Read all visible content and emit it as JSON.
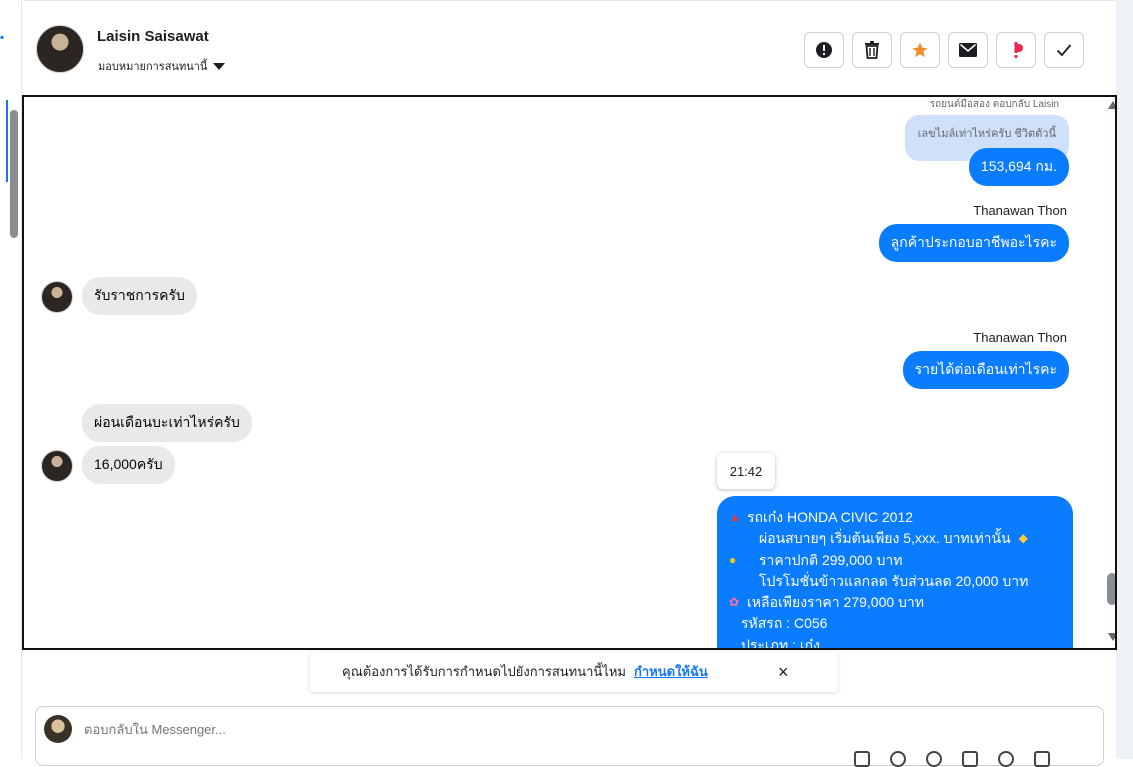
{
  "header": {
    "contact_name": "Laisin Saisawat",
    "assign_label": "มอบหมายการสนทนานี้",
    "actions": [
      {
        "name": "spam-button",
        "icon": "exclamation-circle-icon"
      },
      {
        "name": "delete-button",
        "icon": "trash-icon"
      },
      {
        "name": "star-button",
        "icon": "star-icon",
        "color": "#f28c28"
      },
      {
        "name": "unread-button",
        "icon": "envelope-icon"
      },
      {
        "name": "follow-up-button",
        "icon": "exclamation-icon",
        "color": "#e41e3f"
      },
      {
        "name": "done-button",
        "icon": "checkmark-icon"
      }
    ]
  },
  "chat": {
    "reply_meta": "รถยนต์มือสอง ตอบกลับ Laisin",
    "reply_quote": "เลขไมล์เท่าไหร่ครับ ชีวิตตัวนี้",
    "messages": {
      "m1": "153,694 กม.",
      "sender1": "Thanawan Thon",
      "m2": "ลูกค้าประกอบอาชีพอะไรคะ",
      "m3": "รับราชการครับ",
      "sender2": "Thanawan Thon",
      "m4": "รายได้ต่อเดือนเท่าไรคะ",
      "m5": "ผ่อนเดือนบะเท่าไหร่ครับ",
      "m6": "16,000ครับ"
    },
    "timestamp": "21:42",
    "long_message": {
      "line1": "รถเก๋ง HONDA CIVIC 2012",
      "line2": "ผ่อนสบายๆ เริ่มต้นเพียง 5,xxx. บาทเท่านั้น",
      "line3": "ราคาปกติ  299,000 บาท",
      "line4": "โปรโมชั่นข้าวแลกลด รับส่วนลด 20,000 บาท",
      "line5": "เหลือเพียงราคา 279,000 บาท",
      "line6": "รหัสรถ : C056",
      "line7": "ประเภท : เก๋ง"
    }
  },
  "notice": {
    "text": "คุณต้องการได้รับการกำหนดไปยังการสนทนานี้ไหม",
    "link": "กำหนดให้ฉัน",
    "close": "×"
  },
  "composer": {
    "placeholder": "ตอบกลับใน Messenger..."
  },
  "colors": {
    "outgoing_bubble": "#0a7cff",
    "incoming_bubble": "#e9e9ec",
    "quoted_bubble": "#cfe0fb",
    "link": "#1877f2"
  }
}
